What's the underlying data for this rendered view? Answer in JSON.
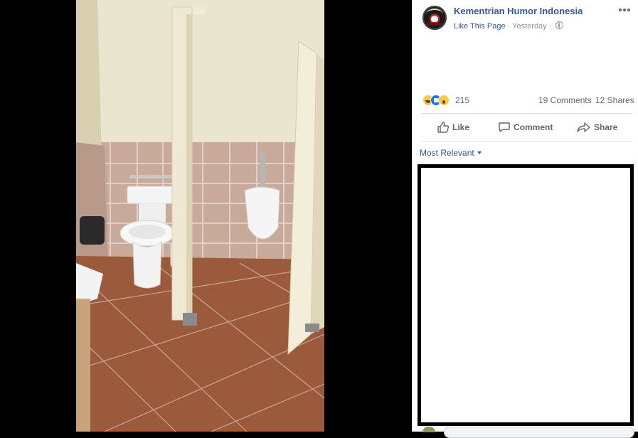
{
  "post": {
    "page_name": "Kementrian Humor Indonesia",
    "like_page": "Like This Page",
    "separator": " · ",
    "time": "Yesterday"
  },
  "stats": {
    "reactions_count": "215",
    "comments": "19 Comments",
    "shares": "12 Shares"
  },
  "actions": {
    "like": "Like",
    "comment": "Comment",
    "share": "Share"
  },
  "comments": {
    "sort": "Most Relevant"
  },
  "icons": {
    "more": "more-options-icon",
    "globe": "globe-icon",
    "reactions": [
      "haha-icon",
      "like-reaction-icon",
      "wow-icon"
    ]
  },
  "colors": {
    "link": "#365899",
    "meta": "#90949c",
    "action": "#606770",
    "divider": "#dadde1"
  }
}
